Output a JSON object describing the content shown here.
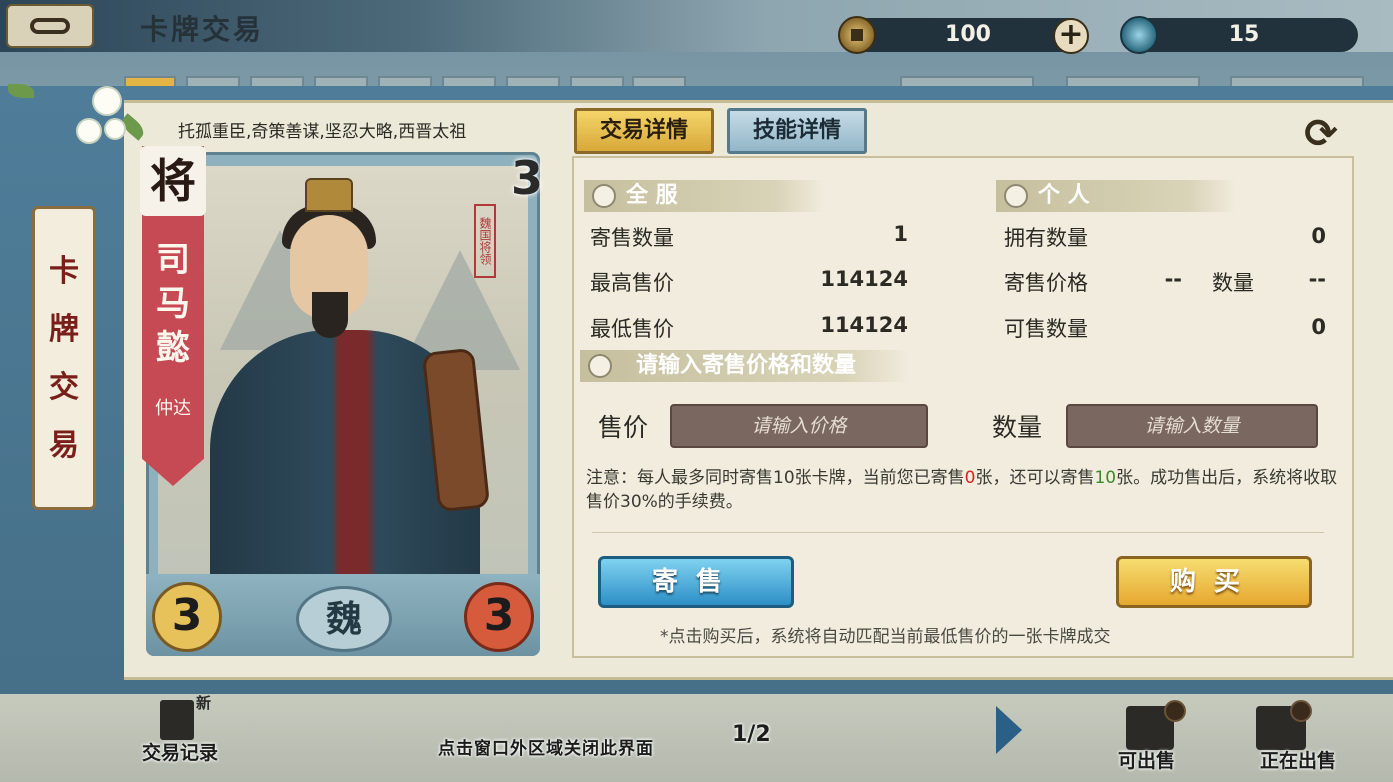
{
  "header": {
    "title": "卡牌交易"
  },
  "resources": {
    "coins": "100",
    "add_symbol": "+",
    "jade": "15"
  },
  "side_tab": {
    "label": "卡牌交易"
  },
  "card": {
    "quote": "托孤重臣,奇策善谋,坚忍大略,西晋太祖",
    "rank": "将",
    "name": "司马懿",
    "courtesy": "仲达",
    "seal": "魏国将领",
    "cost": "3",
    "attack": "3",
    "hp": "3",
    "faction": "魏"
  },
  "tabs": {
    "trade": "交易详情",
    "skill": "技能详情"
  },
  "refresh_symbol": "⟳",
  "server": {
    "heading": "全 服",
    "rows": [
      {
        "label": "寄售数量",
        "value": "1"
      },
      {
        "label": "最高售价",
        "value": "114124"
      },
      {
        "label": "最低售价",
        "value": "114124"
      }
    ]
  },
  "personal": {
    "heading": "个 人",
    "owned_label": "拥有数量",
    "owned_value": "0",
    "price_label": "寄售价格",
    "price_value": "--",
    "qty_label": "数量",
    "qty_value": "--",
    "sellable_label": "可售数量",
    "sellable_value": "0"
  },
  "input_section": {
    "heading": "请输入寄售价格和数量",
    "price_label": "售价",
    "price_placeholder": "请输入价格",
    "qty_label": "数量",
    "qty_placeholder": "请输入数量"
  },
  "notice": {
    "part1": "注意：每人最多同时寄售10张卡牌，当前您已寄售",
    "sold": "0",
    "part2": "张，还可以寄售",
    "remain": "10",
    "part3": "张。成功售出后，系统将收取售价30%的手续费。"
  },
  "actions": {
    "sell": "寄售",
    "buy": "购买",
    "buy_note": "*点击购买后，系统将自动匹配当前最低售价的一张卡牌成交"
  },
  "bottom": {
    "record_label": "交易记录",
    "record_new": "新",
    "close_hint": "点击窗口外区域关闭此界面",
    "page": "1/2",
    "sellable": "可出售",
    "selling": "正在出售"
  },
  "colors": {
    "panel": "#4f7d99",
    "sell_button": "#2d8fc6",
    "buy_button": "#e6a830",
    "accent_red": "#d2271f",
    "accent_green": "#3a8a2a"
  }
}
